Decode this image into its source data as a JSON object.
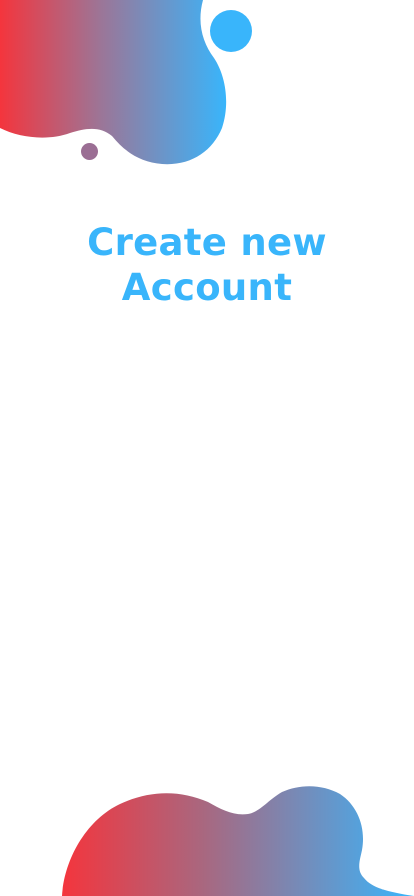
{
  "screen": {
    "title_line1": "Create new",
    "title_line2": "Account"
  },
  "colors": {
    "accent_blue": "#39b5fb",
    "gradient_red": "#f4353d",
    "gradient_blue": "#39b5fb",
    "dot_purple": "#9b6e94",
    "title_text": "#39b5fb",
    "background": "#ffffff"
  }
}
